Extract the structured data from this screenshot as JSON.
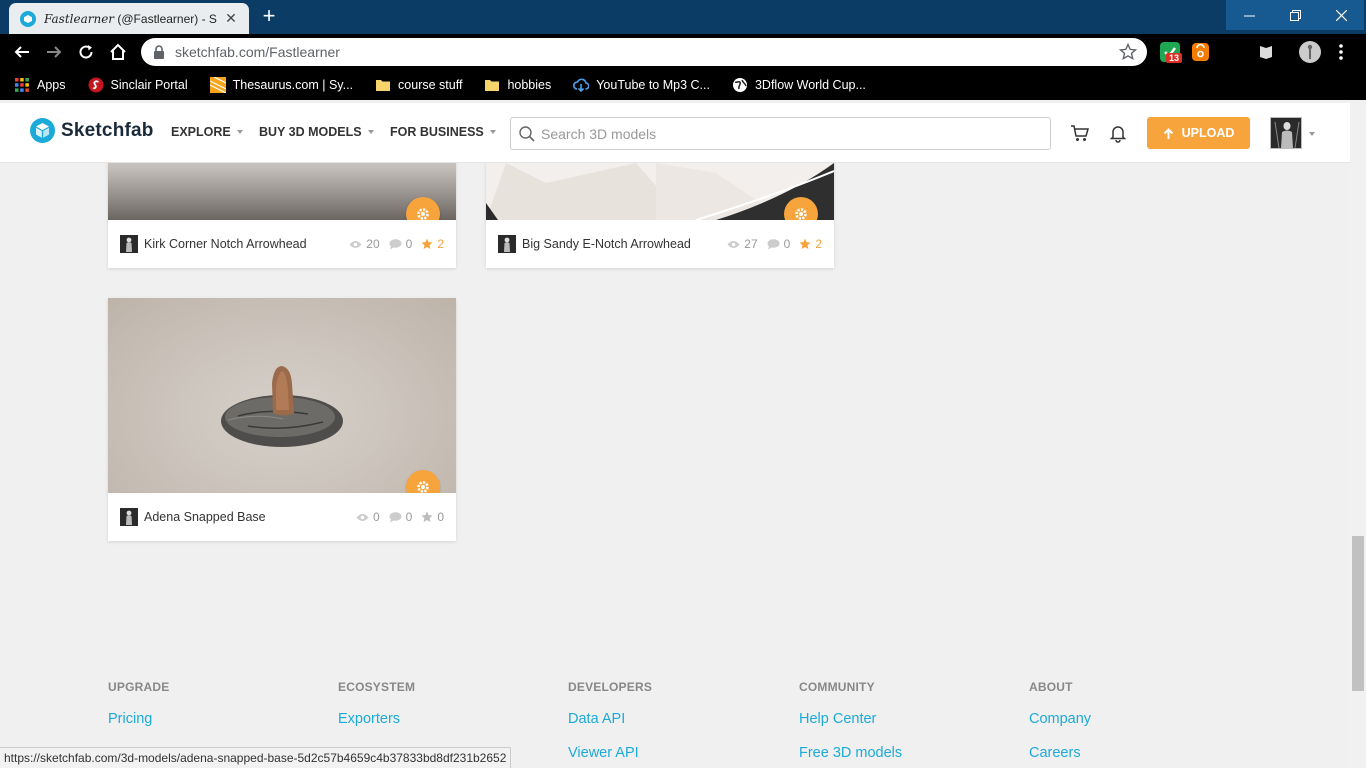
{
  "browser": {
    "tab": {
      "title_italic": "Fastlearner",
      "title_rest": " (@Fastlearner) - S"
    },
    "address": {
      "host": "sketchfab.com",
      "path": "/Fastlearner"
    },
    "extension_badge": "13",
    "bookmarks": [
      {
        "label": "Apps",
        "icon": "apps-grid-icon"
      },
      {
        "label": "Sinclair Portal",
        "icon": "sinclair-icon"
      },
      {
        "label": "Thesaurus.com | Sy...",
        "icon": "thesaurus-icon"
      },
      {
        "label": "course stuff",
        "icon": "folder-icon"
      },
      {
        "label": "hobbies",
        "icon": "folder-icon"
      },
      {
        "label": "YouTube to Mp3 C...",
        "icon": "cloud-download-icon"
      },
      {
        "label": "3Dflow World Cup...",
        "icon": "globe-icon"
      }
    ],
    "status_url": "https://sketchfab.com/3d-models/adena-snapped-base-5d2c57b4659c4b37833bd8df231b2652"
  },
  "header": {
    "logo": "Sketchfab",
    "menu": [
      "EXPLORE",
      "BUY 3D MODELS",
      "FOR BUSINESS"
    ],
    "search_placeholder": "Search 3D models",
    "upload_label": "UPLOAD",
    "accent_color": "#f7a43d",
    "brand_color": "#1caad9"
  },
  "models": [
    {
      "title": "Kirk Corner Notch Arrowhead",
      "views": "20",
      "comments": "0",
      "likes": "2",
      "liked": true
    },
    {
      "title": "Big Sandy E-Notch Arrowhead",
      "views": "27",
      "comments": "0",
      "likes": "2",
      "liked": true
    },
    {
      "title": "Adena Snapped Base",
      "views": "0",
      "comments": "0",
      "likes": "0",
      "liked": false
    }
  ],
  "footer": [
    {
      "heading": "UPGRADE",
      "links": [
        "Pricing"
      ]
    },
    {
      "heading": "ECOSYSTEM",
      "links": [
        "Exporters"
      ]
    },
    {
      "heading": "DEVELOPERS",
      "links": [
        "Data API",
        "Viewer API"
      ]
    },
    {
      "heading": "COMMUNITY",
      "links": [
        "Help Center",
        "Free 3D models"
      ]
    },
    {
      "heading": "ABOUT",
      "links": [
        "Company",
        "Careers"
      ]
    }
  ]
}
